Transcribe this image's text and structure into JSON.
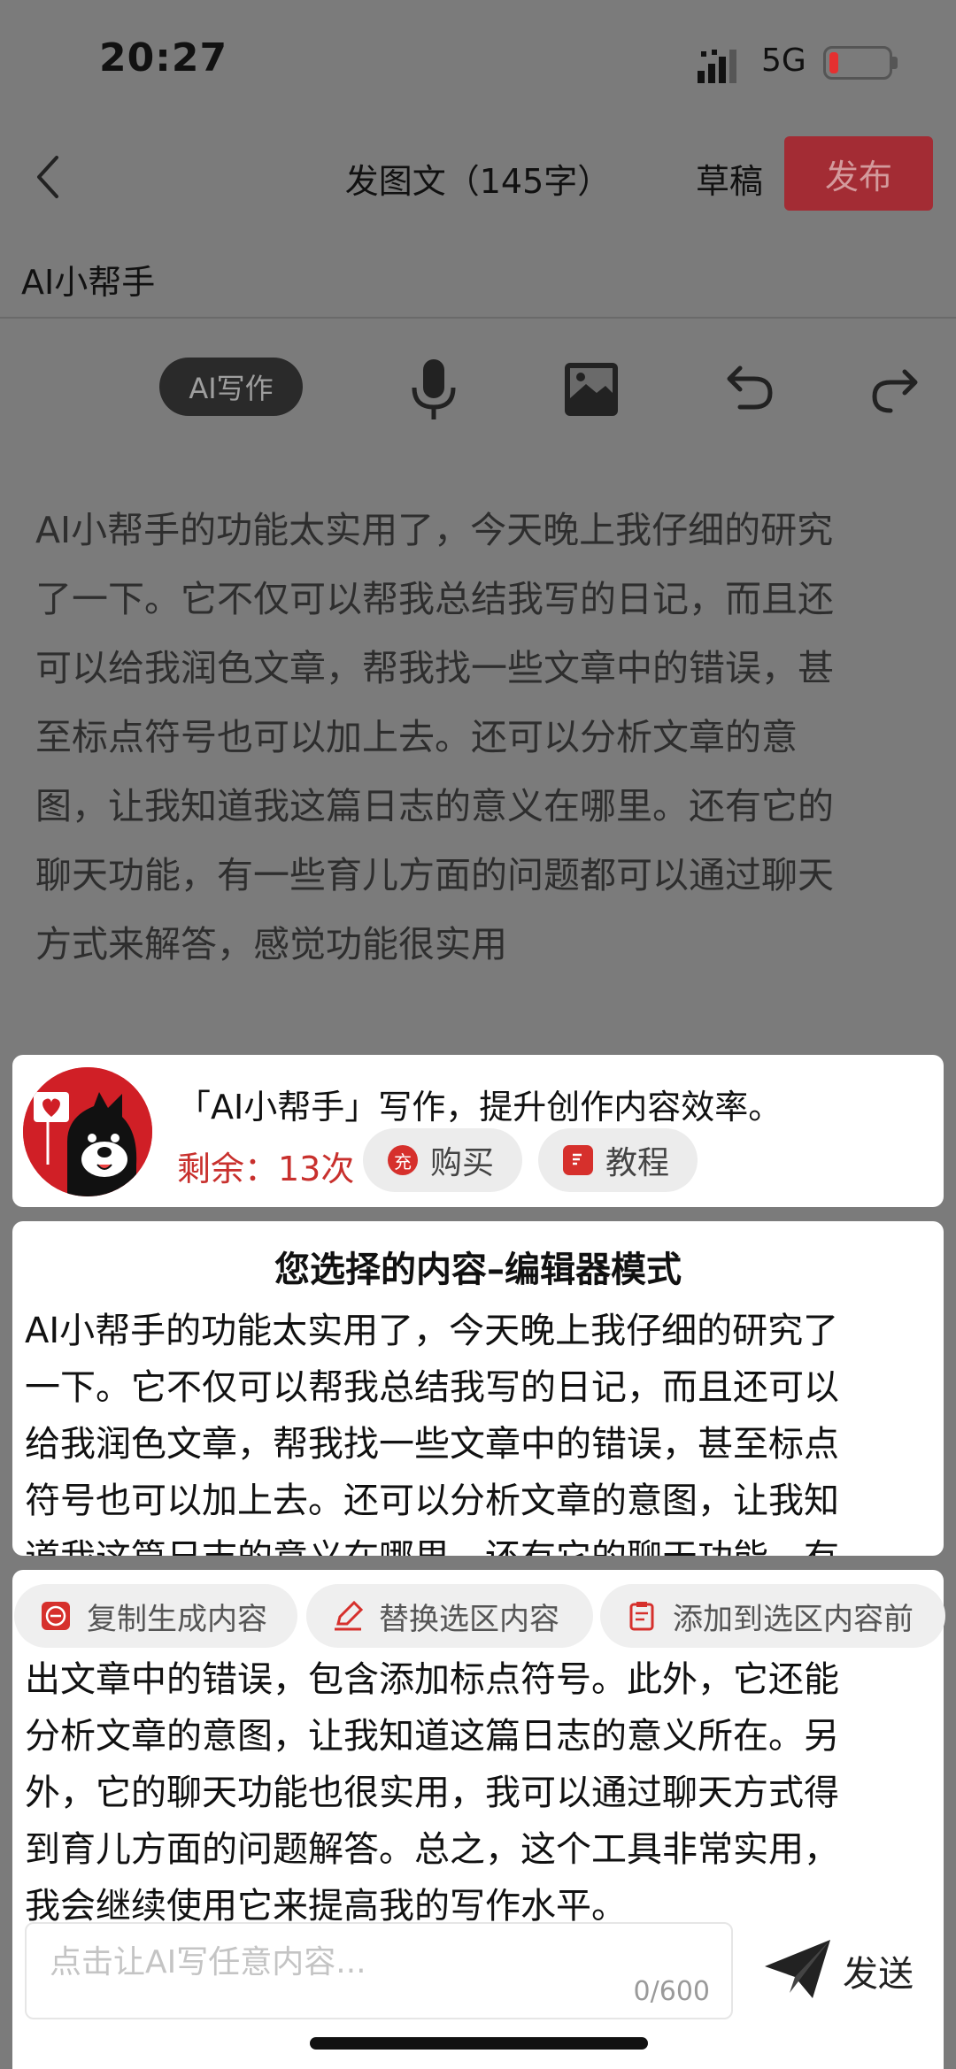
{
  "status_bar": {
    "time": "20:27",
    "network": "5G"
  },
  "nav": {
    "title": "发图文（145字）",
    "draft_label": "草稿",
    "publish_label": "发布"
  },
  "header": {
    "assistant_label": "AI小帮手"
  },
  "toolbar": {
    "ai_write_label": "AI写作",
    "icons": [
      "microphone-icon",
      "image-icon",
      "undo-icon",
      "redo-icon"
    ]
  },
  "editor": {
    "text": "AI小帮手的功能太实用了，今天晚上我仔细的研究\n了一下。它不仅可以帮我总结我写的日记，而且还\n可以给我润色文章，帮我找一些文章中的错误，甚\n至标点符号也可以加上去。还可以分析文章的意\n图，让我知道我这篇日志的意义在哪里。还有它的\n聊天功能，有一些育儿方面的问题都可以通过聊天\n方式来解答，感觉功能很实用"
  },
  "promo": {
    "headline": "「AI小帮手」写作，提升创作内容效率。",
    "remaining": "剩余：13次",
    "buy_label": "购买",
    "buy_icon_char": "充",
    "tutorial_label": "教程"
  },
  "selection_panel": {
    "title": "您选择的内容–编辑器模式",
    "text": "AI小帮手的功能太实用了，今天晚上我仔细的研究了\n一下。它不仅可以帮我总结我写的日记，而且还可以\n给我润色文章，帮我找一些文章中的错误，甚至标点\n符号也可以加上去。还可以分析文章的意图，让我知\n道我这篇日志的意义在哪里。还有它的聊天功能，有"
  },
  "result_panel": {
    "actions": [
      "复制生成内容",
      "替换选区内容",
      "添加到选区内容前"
    ],
    "text": "出文章中的错误，包含添加标点符号。此外，它还能\n分析文章的意图，让我知道这篇日志的意义所在。另\n外，它的聊天功能也很实用，我可以通过聊天方式得\n到育儿方面的问题解答。总之，这个工具非常实用，\n我会继续使用它来提高我的写作水平。",
    "input_placeholder": "点击让AI写任意内容...",
    "counter": "0/600",
    "send_label": "发送"
  },
  "colors": {
    "accent_red": "#d01f26",
    "publish_bg": "#a32c34",
    "overlay": "#7b7b7b"
  }
}
